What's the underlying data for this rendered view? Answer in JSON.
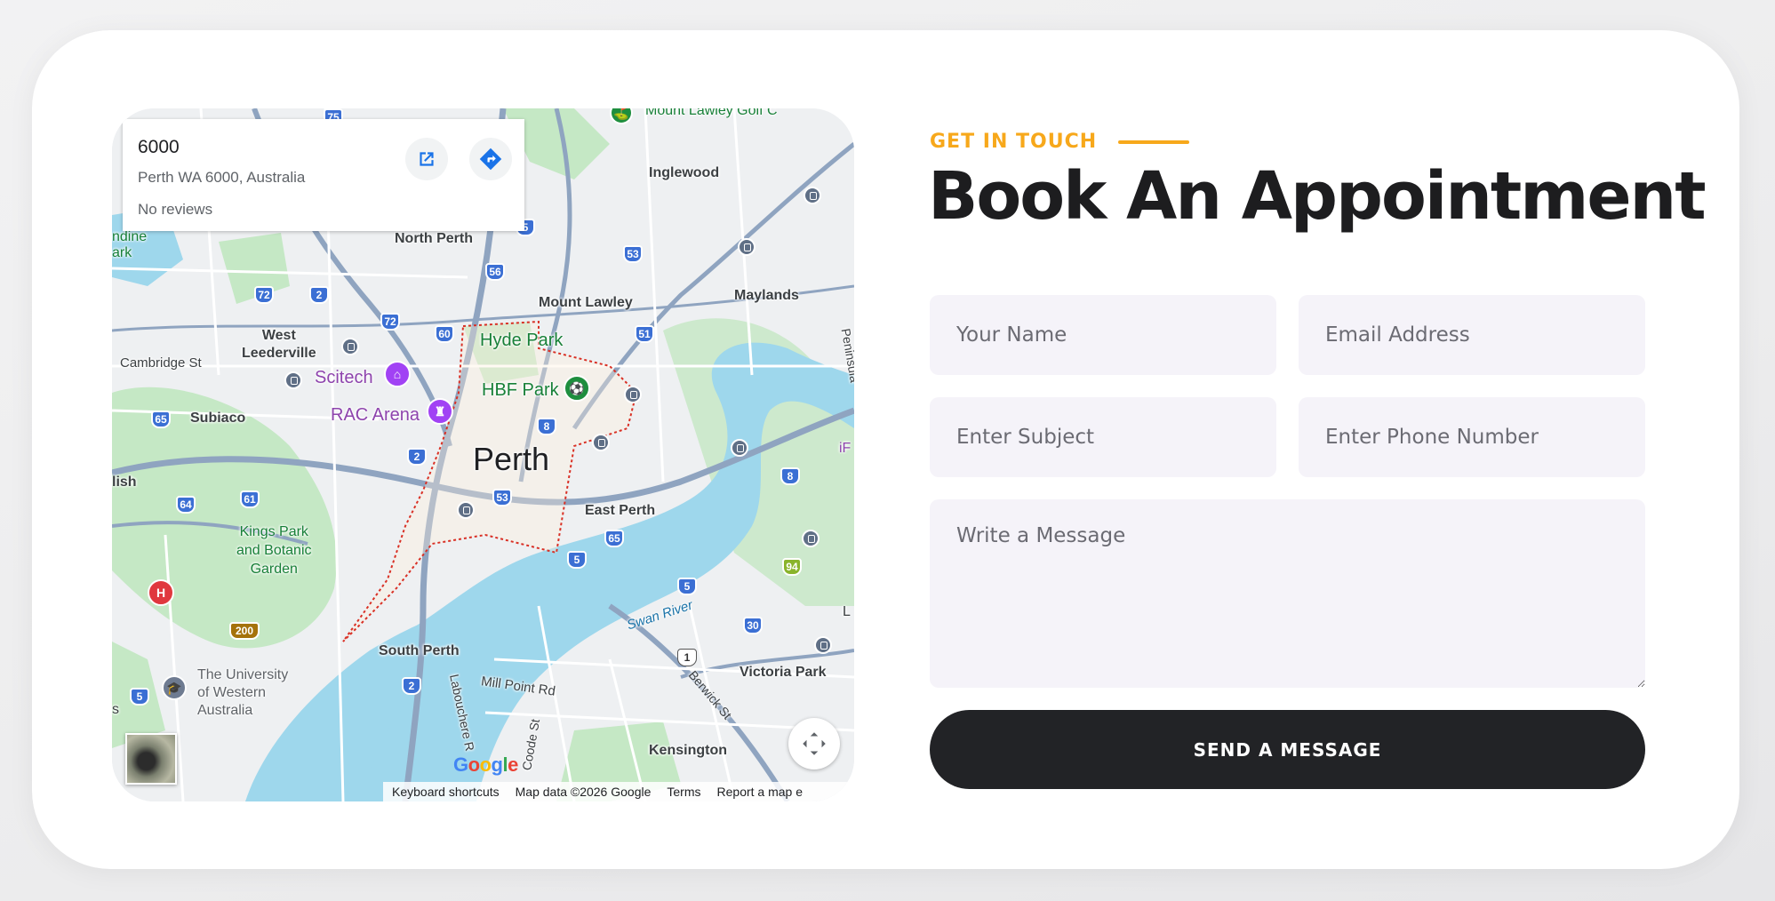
{
  "map": {
    "place_title": "6000",
    "place_address": "Perth WA 6000, Australia",
    "reviews_text": "No reviews",
    "labels": {
      "inglewood": "Inglewood",
      "north_perth": "North Perth",
      "mount_lawley": "Mount Lawley",
      "maylands": "Maylands",
      "west_leederville": "West\nLeederville",
      "cambridge_st": "Cambridge St",
      "scitech": "Scitech",
      "hyde_park": "Hyde Park",
      "hbf_park": "HBF Park",
      "rac_arena": "RAC Arena",
      "subiaco": "Subiaco",
      "perth": "Perth",
      "east_perth": "East Perth",
      "kings_park": "Kings Park\nand Botanic\nGarden",
      "swan_river": "Swan River",
      "south_perth": "South Perth",
      "mill_point_rd": "Mill Point Rd",
      "victoria_park": "Victoria Park",
      "berwick_st": "Berwick St",
      "kensington": "Kensington",
      "uwa": "The University\nof Western\nAustralia",
      "labouchere": "Labouchere R",
      "coode_st": "Coode St",
      "lish": "lish",
      "ndine_park": "ndine\nark",
      "mount_lawley_golf": "Mount Lawley Golf C",
      "peninsula": "Peninsula",
      "if_partial": "iF",
      "l_partial": "L",
      "s_partial": "s",
      "hospital_letter": "H"
    },
    "route_shields": [
      "75",
      "72",
      "2",
      "72",
      "60",
      "56",
      "5",
      "53",
      "51",
      "65",
      "8",
      "2",
      "53",
      "64",
      "61",
      "65",
      "5",
      "5",
      "30",
      "8",
      "94",
      "200",
      "2",
      "5",
      "1"
    ],
    "google_logo": "Google",
    "attribution": {
      "keyboard_shortcuts": "Keyboard shortcuts",
      "map_data": "Map data ©2026 Google",
      "terms": "Terms",
      "report": "Report a map e"
    },
    "colors": {
      "water": "#9ed7ec",
      "park": "#c5e8c5",
      "road": "#ffffff",
      "highway": "#8fa4c0",
      "land": "#eef0f2"
    },
    "icons": {
      "open_external": "open-in-new-icon",
      "directions": "directions-icon",
      "fullscreen": "fullscreen-icon"
    }
  },
  "form": {
    "eyebrow": "GET IN TOUCH",
    "heading": "Book An Appointment",
    "name_placeholder": "Your Name",
    "email_placeholder": "Email Address",
    "subject_placeholder": "Enter Subject",
    "phone_placeholder": "Enter Phone Number",
    "message_placeholder": "Write a Message",
    "submit_label": "SEND A MESSAGE",
    "accent_color": "#f7a81b",
    "field_bg": "#f5f3f9",
    "button_bg": "#222326"
  }
}
